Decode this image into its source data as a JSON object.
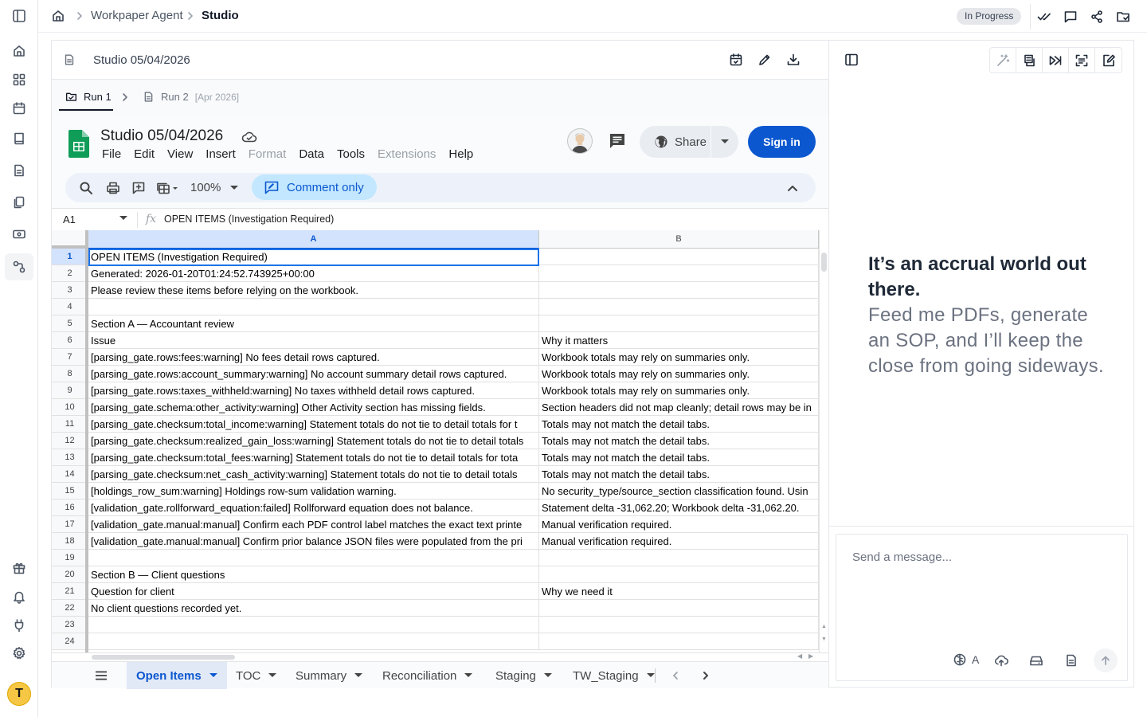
{
  "breadcrumb": {
    "root": "Workpaper Agent",
    "current": "Studio"
  },
  "status_badge": "In Progress",
  "document": {
    "title": "Studio 05/04/2026"
  },
  "runs": [
    {
      "label": "Run 1"
    },
    {
      "label": "Run 2",
      "tag": "[Apr 2026]"
    }
  ],
  "sheets": {
    "title": "Studio 05/04/2026",
    "menu": [
      "File",
      "Edit",
      "View",
      "Insert",
      "Format",
      "Data",
      "Tools",
      "Extensions",
      "Help"
    ],
    "share_label": "Share",
    "signin_label": "Sign in",
    "zoom": "100%",
    "mode_label": "Comment only",
    "name_box": "A1",
    "formula": "OPEN ITEMS (Investigation Required)",
    "columns": [
      "A",
      "B"
    ],
    "rows": [
      {
        "n": "1",
        "a": "OPEN ITEMS (Investigation Required)",
        "b": ""
      },
      {
        "n": "2",
        "a": "Generated: 2026-01-20T01:24:52.743925+00:00",
        "b": ""
      },
      {
        "n": "3",
        "a": "Please review these items before relying on the workbook.",
        "b": ""
      },
      {
        "n": "4",
        "a": "",
        "b": ""
      },
      {
        "n": "5",
        "a": "Section A — Accountant review",
        "b": ""
      },
      {
        "n": "6",
        "a": "Issue",
        "b": "Why it matters"
      },
      {
        "n": "7",
        "a": "[parsing_gate.rows:fees:warning] No fees detail rows captured.",
        "b": "Workbook totals may rely on summaries only."
      },
      {
        "n": "8",
        "a": "[parsing_gate.rows:account_summary:warning] No account summary detail rows captured.",
        "b": "Workbook totals may rely on summaries only."
      },
      {
        "n": "9",
        "a": "[parsing_gate.rows:taxes_withheld:warning] No taxes withheld detail rows captured.",
        "b": "Workbook totals may rely on summaries only."
      },
      {
        "n": "10",
        "a": "[parsing_gate.schema:other_activity:warning] Other Activity section has missing fields.",
        "b": "Section headers did not map cleanly; detail rows may be in"
      },
      {
        "n": "11",
        "a": "[parsing_gate.checksum:total_income:warning] Statement totals do not tie to detail totals for t",
        "b": "Totals may not match the detail tabs."
      },
      {
        "n": "12",
        "a": "[parsing_gate.checksum:realized_gain_loss:warning] Statement totals do not tie to detail totals",
        "b": "Totals may not match the detail tabs."
      },
      {
        "n": "13",
        "a": "[parsing_gate.checksum:total_fees:warning] Statement totals do not tie to detail totals for tota",
        "b": "Totals may not match the detail tabs."
      },
      {
        "n": "14",
        "a": "[parsing_gate.checksum:net_cash_activity:warning] Statement totals do not tie to detail totals",
        "b": "Totals may not match the detail tabs."
      },
      {
        "n": "15",
        "a": "[holdings_row_sum:warning] Holdings row-sum validation warning.",
        "b": "No security_type/source_section classification found. Usin"
      },
      {
        "n": "16",
        "a": "[validation_gate.rollforward_equation:failed] Rollforward equation does not balance.",
        "b": "Statement delta -31,062.20; Workbook delta -31,062.20."
      },
      {
        "n": "17",
        "a": "[validation_gate.manual:manual] Confirm each PDF control label matches the exact text printe",
        "b": "Manual verification required."
      },
      {
        "n": "18",
        "a": "[validation_gate.manual:manual] Confirm prior balance JSON files were populated from the pri",
        "b": "Manual verification required."
      },
      {
        "n": "19",
        "a": "",
        "b": ""
      },
      {
        "n": "20",
        "a": "Section B — Client questions",
        "b": ""
      },
      {
        "n": "21",
        "a": "Question for client",
        "b": "Why we need it"
      },
      {
        "n": "22",
        "a": "No client questions recorded yet.",
        "b": ""
      },
      {
        "n": "23",
        "a": "",
        "b": ""
      },
      {
        "n": "24",
        "a": "",
        "b": ""
      }
    ],
    "tabs": [
      "Open Items",
      "TOC",
      "Summary",
      "Reconciliation",
      "Staging",
      "TW_Staging"
    ],
    "active_tab": "Open Items"
  },
  "assistant": {
    "headline": "It’s an accrual world out there.",
    "subline": "Feed me PDFs, generate an SOP, and I’ll keep the close from going sideways.",
    "chat_placeholder": "Send a message...",
    "model_label": "A"
  },
  "icons": {
    "rail": [
      "sidebar-toggle-icon",
      "home-icon",
      "dashboard-icon",
      "calendar-icon",
      "book-icon",
      "document-icon",
      "copy-icon",
      "card-icon",
      "workflow-icon",
      "gift-icon",
      "bell-icon",
      "plug-icon",
      "settings-icon"
    ],
    "topbar": [
      "check-all-icon",
      "comment-icon",
      "share-icon",
      "folder-icon"
    ],
    "accent": "#0b57d0",
    "sheets_green": "#0f9d58"
  }
}
